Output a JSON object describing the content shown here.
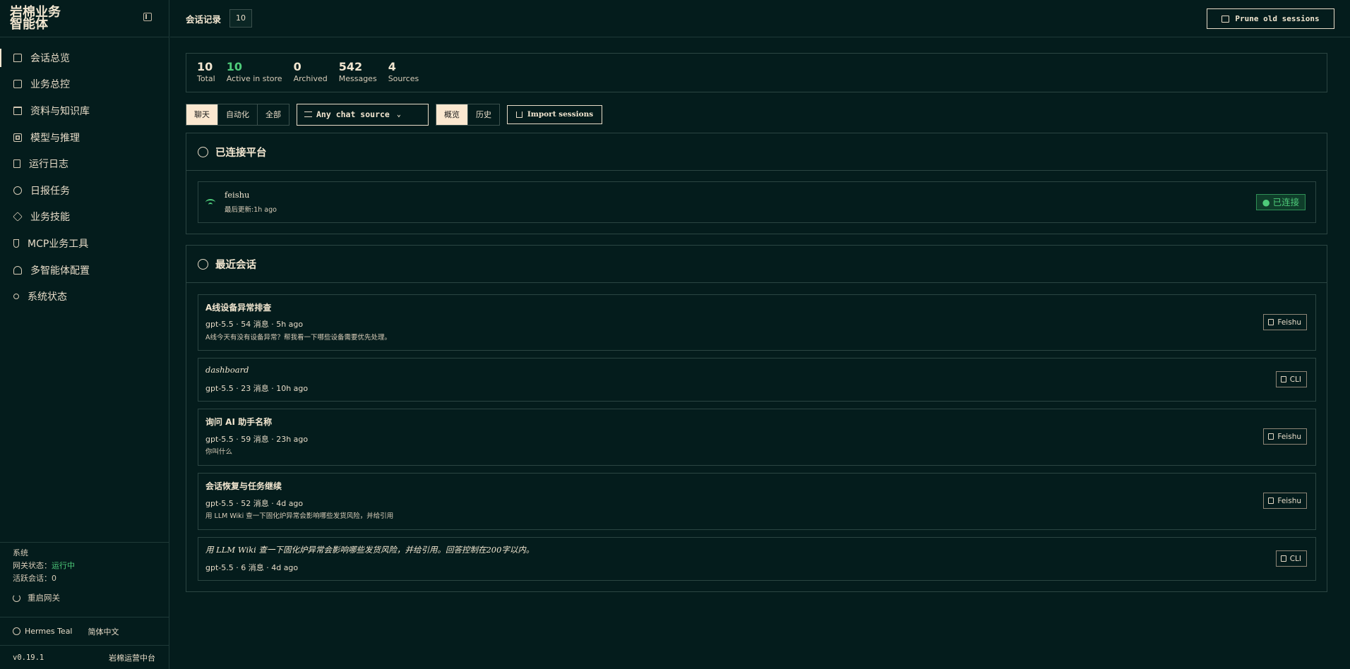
{
  "brand": {
    "title": "岩棉业务智能体"
  },
  "sidebar": {
    "items": [
      {
        "label": "会话总览",
        "icon": "message-icon",
        "active": true
      },
      {
        "label": "业务总控",
        "icon": "chart-icon"
      },
      {
        "label": "资料与知识库",
        "icon": "folder-icon"
      },
      {
        "label": "模型与推理",
        "icon": "cpu-icon"
      },
      {
        "label": "运行日志",
        "icon": "file-text-icon"
      },
      {
        "label": "日报任务",
        "icon": "clock-icon"
      },
      {
        "label": "业务技能",
        "icon": "package-icon"
      },
      {
        "label": "MCP业务工具",
        "icon": "plug-icon"
      },
      {
        "label": "多智能体配置",
        "icon": "users-icon"
      },
      {
        "label": "系统状态",
        "icon": "wrench-icon"
      }
    ],
    "system": {
      "heading": "系统",
      "gateway_label": "网关状态：",
      "gateway_value": "运行中",
      "active_label": "活跃会话：",
      "active_value": "0",
      "restart_label": "重启网关"
    },
    "theme_label": "Hermes Teal",
    "language_label": "简体中文",
    "version": "v0.19.1",
    "footer_brand": "岩棉运营中台"
  },
  "topbar": {
    "title": "会话记录",
    "count": "10",
    "prune_label": "Prune old sessions"
  },
  "stats": [
    {
      "value": "10",
      "label": "Total"
    },
    {
      "value": "10",
      "label": "Active in store",
      "color": "#4ecb7a"
    },
    {
      "value": "0",
      "label": "Archived"
    },
    {
      "value": "542",
      "label": "Messages"
    },
    {
      "value": "4",
      "label": "Sources"
    }
  ],
  "toolbar": {
    "filter_tabs": [
      "聊天",
      "自动化",
      "全部"
    ],
    "filter_selected": "聊天",
    "source_select": "Any chat source",
    "view_tabs": [
      "概览",
      "历史"
    ],
    "view_selected": "概览",
    "import_label": "Import sessions"
  },
  "platforms": {
    "title": "已连接平台",
    "items": [
      {
        "name": "feishu",
        "meta": "最后更新:1h ago",
        "status": "● 已连接"
      }
    ]
  },
  "recent": {
    "title": "最近会话",
    "items": [
      {
        "title": "A线设备异常排查",
        "meta": "gpt-5.5 · 54 消息 · 5h ago",
        "preview": "A线今天有没有设备异常？帮我看一下哪些设备需要优先处理。",
        "source": "Feishu"
      },
      {
        "title": "dashboard",
        "meta": "gpt-5.5 · 23 消息 · 10h ago",
        "preview": "",
        "source": "CLI"
      },
      {
        "title": "询问 AI 助手名称",
        "meta": "gpt-5.5 · 59 消息 · 23h ago",
        "preview": "你叫什么",
        "source": "Feishu"
      },
      {
        "title": "会话恢复与任务继续",
        "meta": "gpt-5.5 · 52 消息 · 4d ago",
        "preview": "用 LLM Wiki 查一下固化炉异常会影响哪些发货风险，并给引用",
        "source": "Feishu"
      },
      {
        "title": "用 LLM Wiki 查一下固化炉异常会影响哪些发货风险，并给引用。回答控制在200字以内。",
        "meta": "gpt-5.5 · 6 消息 · 4d ago",
        "preview": "",
        "source": "CLI"
      }
    ]
  }
}
